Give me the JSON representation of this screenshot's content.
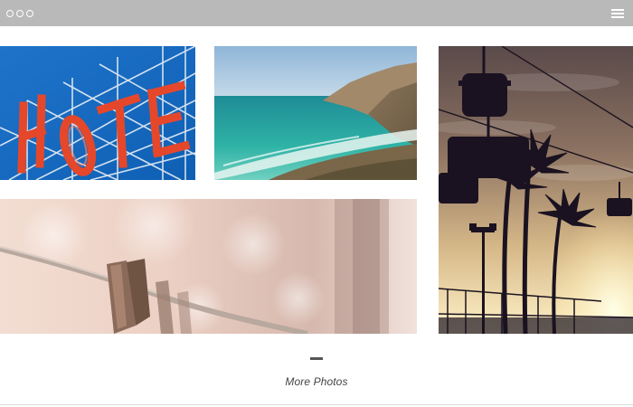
{
  "window": {
    "title_bar_color": "#b9b9b9",
    "controls_icon": "three-circle-window-controls",
    "menu_icon": "hamburger-menu-icon"
  },
  "gallery": {
    "photos": [
      {
        "id": "hotel",
        "subject": "hotel-sign-photo",
        "sign_text": "HOTE"
      },
      {
        "id": "coast",
        "subject": "ocean-coastline-photo"
      },
      {
        "id": "sunset",
        "subject": "palm-trees-chairlift-sunset-photo"
      },
      {
        "id": "clothes",
        "subject": "clothespins-on-line-photo"
      }
    ]
  },
  "footer": {
    "more_label": "More Photos"
  }
}
